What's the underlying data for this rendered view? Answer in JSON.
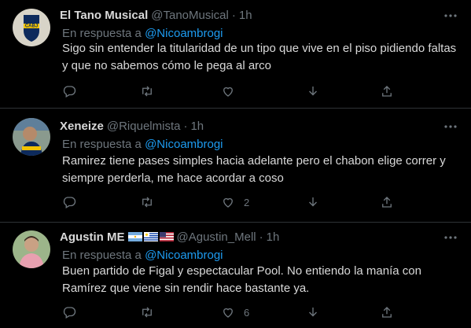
{
  "colors": {
    "background": "#000000",
    "text": "#d9d9d9",
    "muted": "#6e767d",
    "link": "#1d9bf0",
    "divider": "#2f3336"
  },
  "reply_prefix": "En respuesta a",
  "tweets": [
    {
      "name": "El Tano Musical",
      "handle": "@TanoMusical",
      "separator": "·",
      "time": "1h",
      "reply_to": "@Nicoambrogi",
      "lines": [
        "Sigo sin entender la titularidad de un tipo que vive en el piso pidiendo faltas",
        "y que no sabemos cómo le pega al arco"
      ],
      "replies": "",
      "retweets": "",
      "likes": ""
    },
    {
      "name": "Xeneize",
      "handle": "@Riquelmista",
      "separator": "·",
      "time": "1h",
      "reply_to": "@Nicoambrogi",
      "lines": [
        "Ramirez tiene pases simples hacia adelante pero el chabon elige correr y",
        "siempre perderla, me hace acordar a coso"
      ],
      "replies": "",
      "retweets": "",
      "likes": "2"
    },
    {
      "name": "Agustin ME",
      "flags": [
        "argentina-flag",
        "uruguay-flag",
        "usa-flag"
      ],
      "handle": "@Agustin_Mell",
      "separator": "·",
      "time": "1h",
      "reply_to": "@Nicoambrogi",
      "lines": [
        "Buen partido de Figal y espectacular Pool. No entiendo la manía con",
        "Ramírez que viene sin rendir hace bastante ya."
      ],
      "replies": "",
      "retweets": "",
      "likes": "6"
    }
  ],
  "icons": [
    "reply-icon",
    "retweet-icon",
    "like-icon",
    "download-icon",
    "share-icon",
    "more-icon"
  ]
}
